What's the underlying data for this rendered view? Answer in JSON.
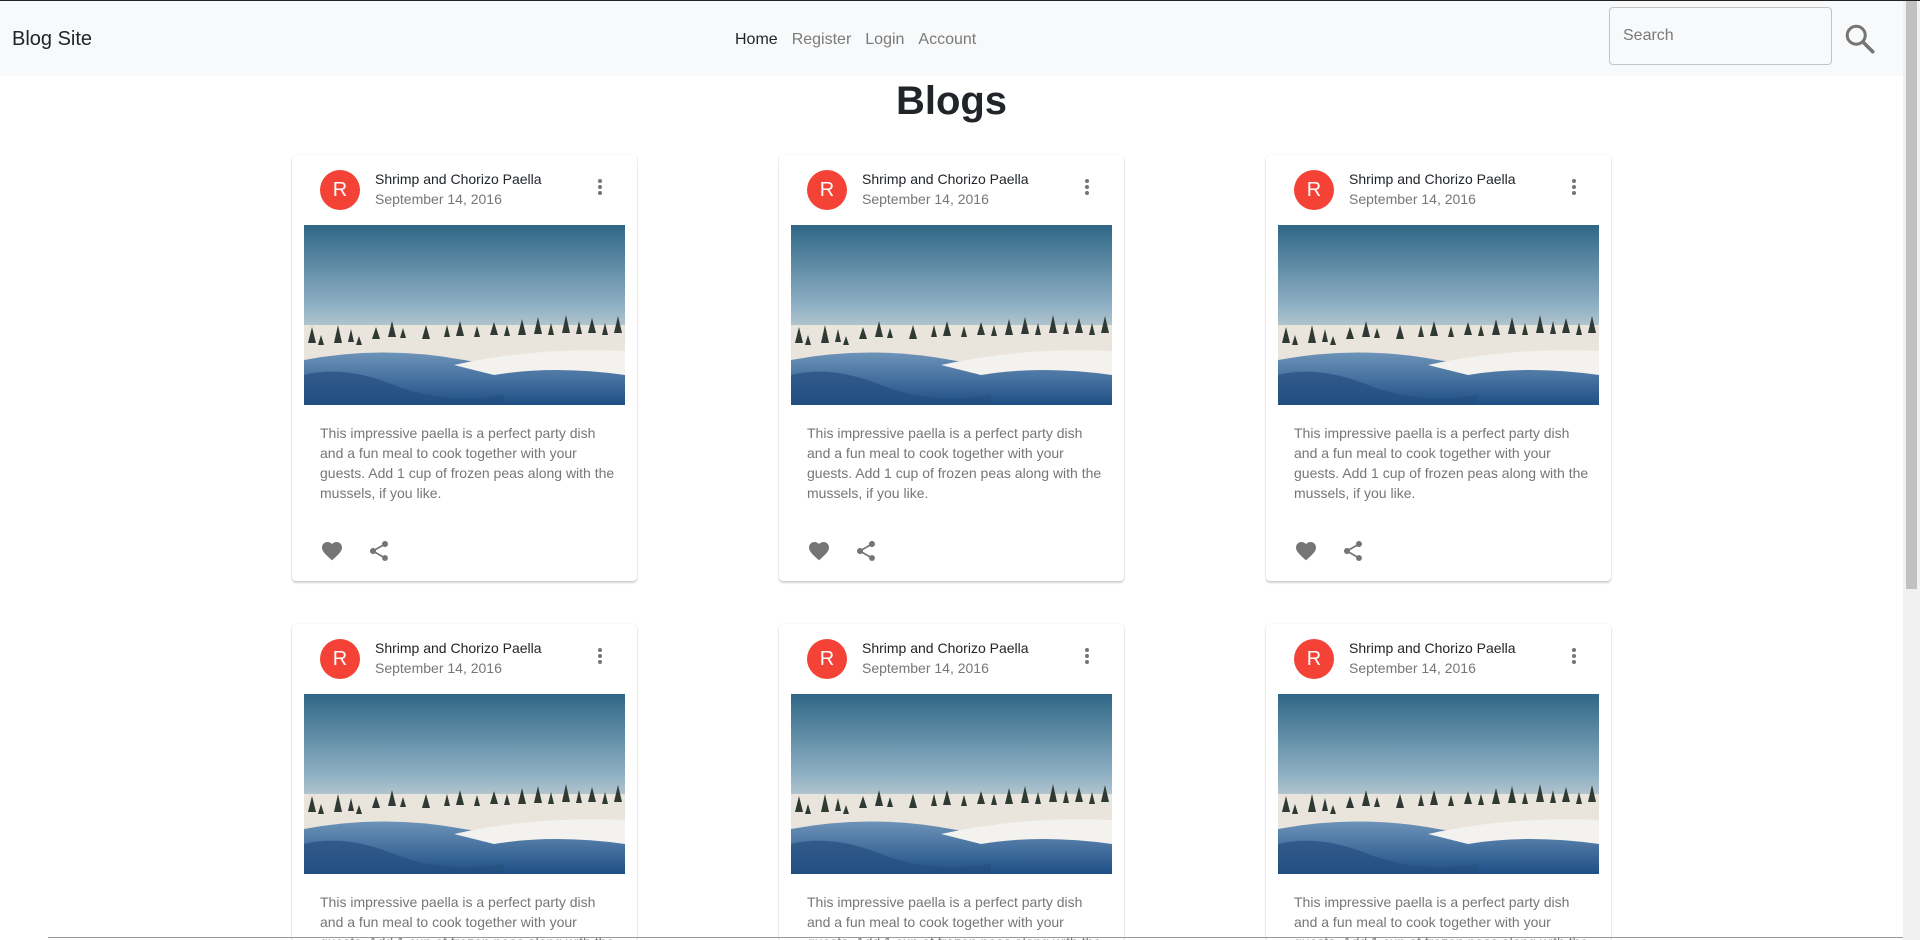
{
  "navbar": {
    "brand": "Blog Site",
    "links": [
      "Home",
      "Register",
      "Login",
      "Account"
    ],
    "search_placeholder": "Search"
  },
  "page_title": "Blogs",
  "cards": [
    {
      "avatar": "R",
      "title": "Shrimp and Chorizo Paella",
      "date": "September 14, 2016",
      "text": "This impressive paella is a perfect party dish and a fun meal to cook together with your guests. Add 1 cup of frozen peas along with the mussels, if you like."
    },
    {
      "avatar": "R",
      "title": "Shrimp and Chorizo Paella",
      "date": "September 14, 2016",
      "text": "This impressive paella is a perfect party dish and a fun meal to cook together with your guests. Add 1 cup of frozen peas along with the mussels, if you like."
    },
    {
      "avatar": "R",
      "title": "Shrimp and Chorizo Paella",
      "date": "September 14, 2016",
      "text": "This impressive paella is a perfect party dish and a fun meal to cook together with your guests. Add 1 cup of frozen peas along with the mussels, if you like."
    },
    {
      "avatar": "R",
      "title": "Shrimp and Chorizo Paella",
      "date": "September 14, 2016",
      "text": "This impressive paella is a perfect party dish and a fun meal to cook together with your guests. Add 1 cup of frozen peas along with the mussels, if you like."
    },
    {
      "avatar": "R",
      "title": "Shrimp and Chorizo Paella",
      "date": "September 14, 2016",
      "text": "This impressive paella is a perfect party dish and a fun meal to cook together with your guests. Add 1 cup of frozen peas along with the mussels, if you like."
    },
    {
      "avatar": "R",
      "title": "Shrimp and Chorizo Paella",
      "date": "September 14, 2016",
      "text": "This impressive paella is a perfect party dish and a fun meal to cook together with your guests. Add 1 cup of frozen peas along with the mussels, if you like."
    }
  ],
  "colors": {
    "avatar": "#f44336",
    "navbar_bg": "#f8f9fa",
    "icon": "#757575"
  },
  "icons": [
    "search-icon",
    "more-vert-icon",
    "heart-icon",
    "share-icon"
  ]
}
